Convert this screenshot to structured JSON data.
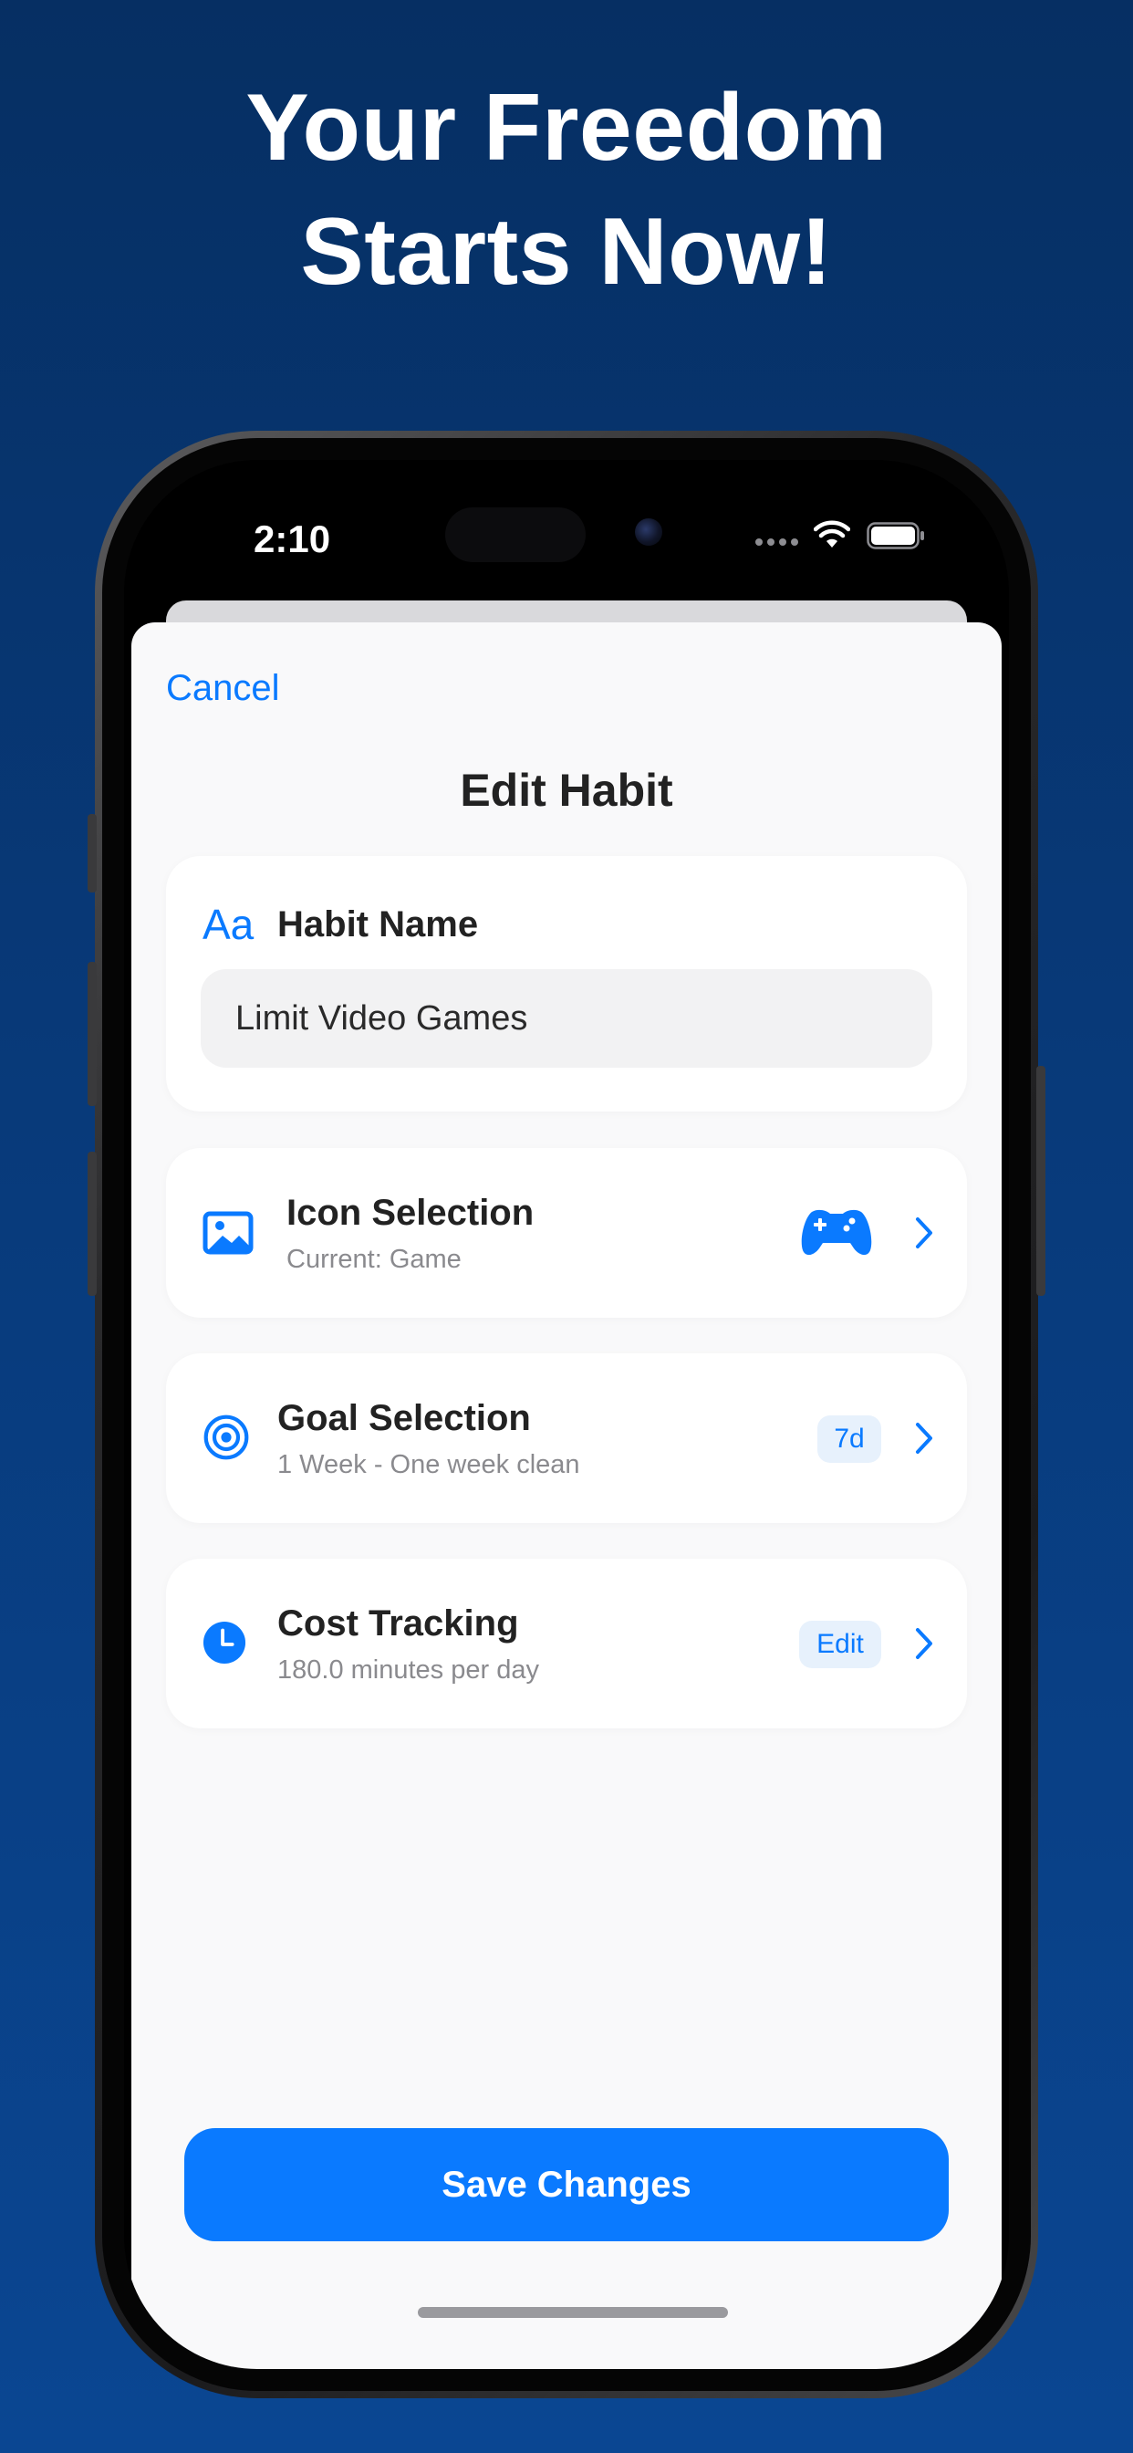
{
  "headline": {
    "line1": "Your Freedom",
    "line2": "Starts Now!"
  },
  "status_bar": {
    "time": "2:10"
  },
  "sheet": {
    "cancel_label": "Cancel",
    "title": "Edit Habit"
  },
  "habit_name": {
    "icon_text": "Aa",
    "label": "Habit Name",
    "value": "Limit Video Games"
  },
  "icon_selection": {
    "title": "Icon Selection",
    "subtitle": "Current: Game",
    "icon": "gamecontroller-icon"
  },
  "goal_selection": {
    "title": "Goal Selection",
    "subtitle": "1 Week - One week clean",
    "badge": "7d",
    "icon": "target-icon"
  },
  "cost_tracking": {
    "title": "Cost Tracking",
    "subtitle": "180.0 minutes per day",
    "badge": "Edit",
    "icon": "clock-icon"
  },
  "save_button": {
    "label": "Save Changes"
  },
  "colors": {
    "accent": "#0a7aff",
    "background_top": "#062f63",
    "background_bottom": "#0a4692",
    "sheet": "#f9f9fa",
    "card": "#ffffff",
    "badge_bg": "#e7f1fc"
  }
}
